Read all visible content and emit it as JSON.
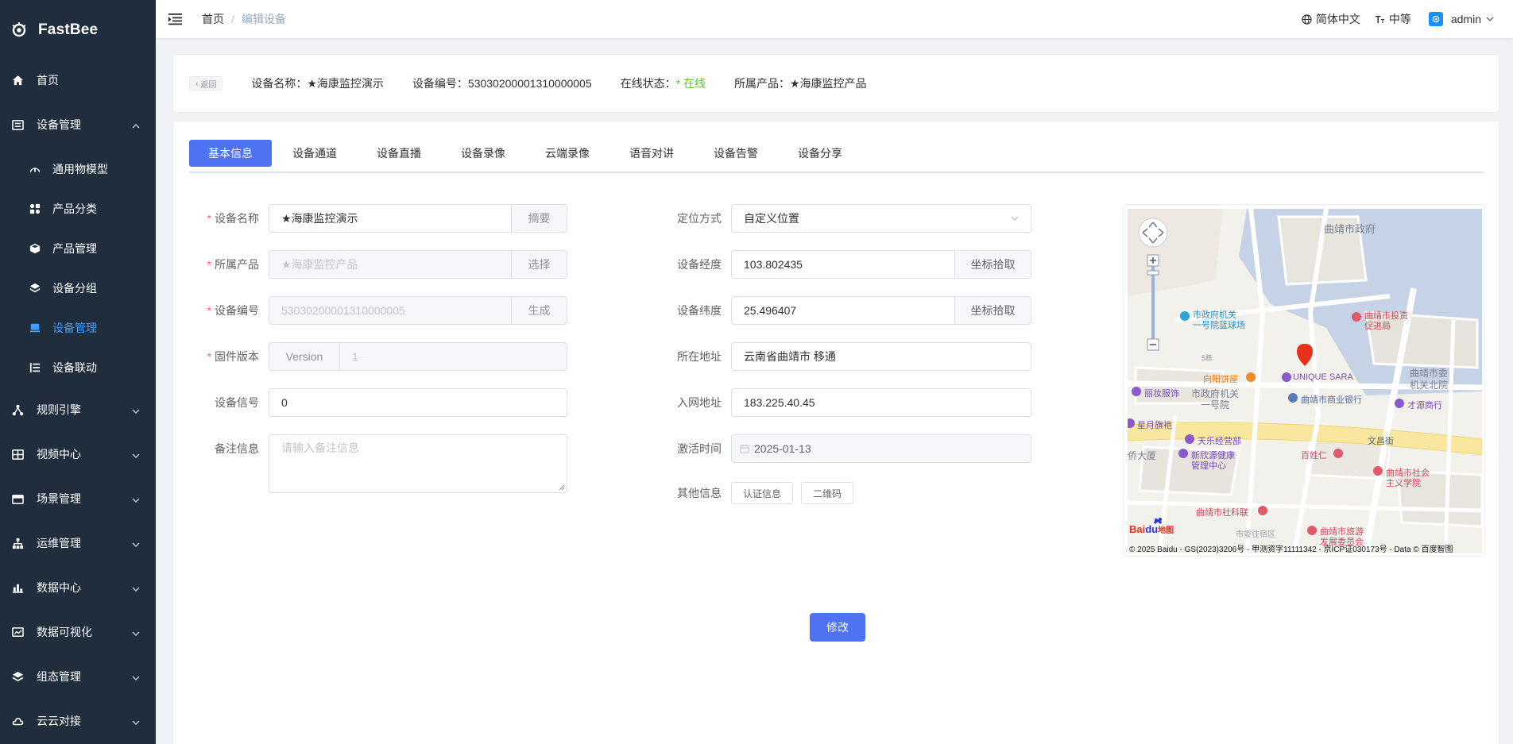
{
  "app": {
    "name": "FastBee"
  },
  "sidebar": {
    "items": [
      {
        "label": "首页"
      },
      {
        "label": "设备管理"
      },
      {
        "label": "规则引擎"
      },
      {
        "label": "视频中心"
      },
      {
        "label": "场景管理"
      },
      {
        "label": "运维管理"
      },
      {
        "label": "数据中心"
      },
      {
        "label": "数据可视化"
      },
      {
        "label": "组态管理"
      },
      {
        "label": "云云对接"
      }
    ],
    "sub_items": [
      {
        "label": "通用物模型"
      },
      {
        "label": "产品分类"
      },
      {
        "label": "产品管理"
      },
      {
        "label": "设备分组"
      },
      {
        "label": "设备管理"
      },
      {
        "label": "设备联动"
      }
    ]
  },
  "header": {
    "breadcrumb": [
      "首页",
      "/",
      "编辑设备"
    ],
    "language": "简体中文",
    "size": "中等",
    "user": "admin"
  },
  "info": {
    "back_label": "返回",
    "name": "设备名称：★海康监控演示",
    "serial": "设备编号：53030200001310000005",
    "status_label": "在线状态：",
    "status_value": "* 在线",
    "product": "所属产品：★海康监控产品"
  },
  "tabs": [
    "基本信息",
    "设备通道",
    "设备直播",
    "设备录像",
    "云端录像",
    "语音对讲",
    "设备告警",
    "设备分享"
  ],
  "form_left": {
    "device_name_label": "设备名称",
    "device_name_value": "★海康监控演示",
    "device_name_btn": "摘要",
    "product_label": "所属产品",
    "product_placeholder": "★海康监控产品",
    "product_btn": "选择",
    "serial_label": "设备编号",
    "serial_value": "53030200001310000005",
    "serial_btn": "生成",
    "firmware_label": "固件版本",
    "firmware_prefix": "Version",
    "firmware_value": "1",
    "signal_label": "设备信号",
    "signal_value": "0",
    "remark_label": "备注信息",
    "remark_placeholder": "请输入备注信息"
  },
  "form_right": {
    "locate_label": "定位方式",
    "locate_value": "自定义位置",
    "lng_label": "设备经度",
    "lng_value": "103.802435",
    "lng_btn": "坐标拾取",
    "lat_label": "设备纬度",
    "lat_value": "25.496407",
    "lat_btn": "坐标拾取",
    "address_label": "所在地址",
    "address_value": "云南省曲靖市 移通",
    "ip_label": "入网地址",
    "ip_value": "183.225.40.45",
    "active_label": "激活时间",
    "active_value": "2025-01-13",
    "other_label": "其他信息",
    "auth_btn": "认证信息",
    "qr_btn": "二维码"
  },
  "map": {
    "labels": [
      "曲靖市政府",
      "市政府机关",
      "一号院篮球场",
      "曲靖市投资",
      "促进局",
      "5栋",
      "向阳饼屋",
      "UNIQUE SARA",
      "曲靖市委",
      "机关北院",
      "丽妆服饰",
      "市政府机关",
      "一号院",
      "曲靖市商业银行",
      "才源商行",
      "星月旗袍",
      "天乐经营部",
      "文昌街",
      "新欣源健康",
      "管理中心",
      "百姓仁",
      "侨大厦",
      "曲靖市社会",
      "主义学院",
      "曲靖市社科联",
      "市委住宿区",
      "曲靖市旅游",
      "发展委员会"
    ],
    "copyright": "© 2025 Baidu - GS(2023)3206号 - 甲测资字11111342 - 京ICP证030173号 - Data © 百度智图"
  },
  "submit_label": "修改"
}
